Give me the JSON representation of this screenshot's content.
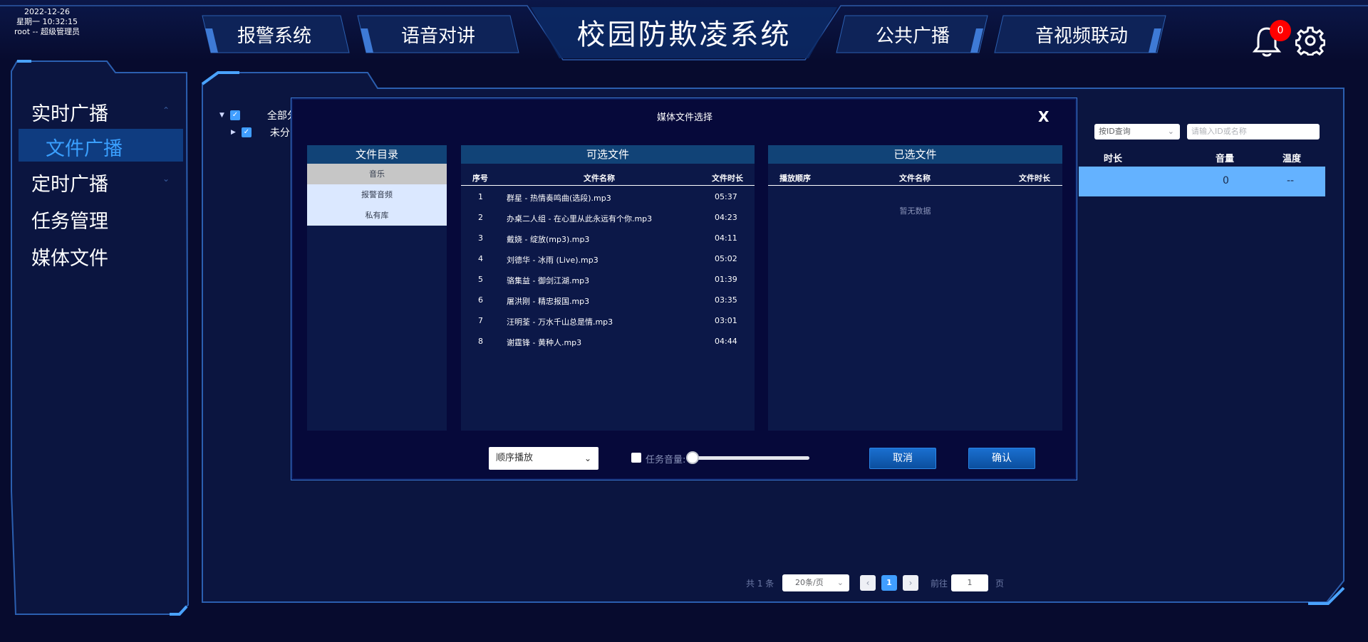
{
  "header": {
    "date": "2022-12-26",
    "weekday_time": "星期一 10:32:15",
    "user": "root -- 超级管理员",
    "title": "校园防欺凌系统",
    "tabs": [
      "报警系统",
      "语音对讲",
      "公共广播",
      "音视频联动"
    ],
    "notification_count": "0"
  },
  "sidebar": {
    "items": [
      "实时广播",
      "文件广播",
      "定时广播",
      "任务管理",
      "媒体文件"
    ],
    "active_index": 1
  },
  "background": {
    "tree": [
      "全部分",
      "未分"
    ],
    "query_select": "按ID查询",
    "search_placeholder": "请输入ID或名称",
    "columns": [
      "时长",
      "音量",
      "温度"
    ],
    "row": {
      "volume": "0",
      "temperature": "--"
    },
    "pager": {
      "total": "共 1 条",
      "page_size": "20条/页",
      "current_page": "1",
      "goto_label": "前往",
      "goto_value": "1",
      "page_suffix": "页"
    }
  },
  "modal": {
    "title": "媒体文件选择",
    "close": "X",
    "directory": {
      "header": "文件目录",
      "items": [
        "音乐",
        "报警音频",
        "私有库"
      ],
      "selected_index": 0
    },
    "available": {
      "header": "可选文件",
      "columns": [
        "序号",
        "文件名称",
        "文件时长"
      ],
      "rows": [
        {
          "index": "1",
          "name": "群星 - 热情奏鸣曲(选段).mp3",
          "duration": "05:37"
        },
        {
          "index": "2",
          "name": "办桌二人组 - 在心里从此永远有个你.mp3",
          "duration": "04:23"
        },
        {
          "index": "3",
          "name": "戴娆 - 绽放(mp3).mp3",
          "duration": "04:11"
        },
        {
          "index": "4",
          "name": "刘德华 - 冰雨 (Live).mp3",
          "duration": "05:02"
        },
        {
          "index": "5",
          "name": "骆集益 - 御剑江湖.mp3",
          "duration": "01:39"
        },
        {
          "index": "6",
          "name": "屠洪刚 - 精忠报国.mp3",
          "duration": "03:35"
        },
        {
          "index": "7",
          "name": "汪明荃 - 万水千山总是情.mp3",
          "duration": "03:01"
        },
        {
          "index": "8",
          "name": "谢霆锋 - 黄种人.mp3",
          "duration": "04:44"
        }
      ]
    },
    "selected": {
      "header": "已选文件",
      "columns": [
        "播放顺序",
        "文件名称",
        "文件时长"
      ],
      "empty_text": "暂无数据"
    },
    "play_mode": "顺序播放",
    "volume_label": "任务音量:",
    "volume_level": 0,
    "cancel_label": "取消",
    "confirm_label": "确认"
  },
  "colors": {
    "background": "#070b2e",
    "accent": "#409eff",
    "panel_header": "#114377",
    "badge": "#ff0000"
  }
}
